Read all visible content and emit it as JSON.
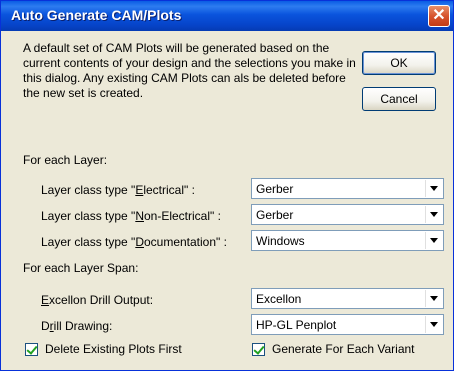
{
  "window": {
    "title": "Auto Generate CAM/Plots",
    "close_symbol": "✕"
  },
  "description": "A default set of CAM Plots will be generated based on the current contents of your design and the selections you make in this dialog. Any existing CAM Plots can als be deleted before the new set is created.",
  "buttons": {
    "ok_label": "OK",
    "cancel_label": "Cancel"
  },
  "layer_section": {
    "heading": "For each Layer:",
    "fields": [
      {
        "label_pre": "Layer class type \"",
        "label_ul": "E",
        "label_post": "lectrical\" :",
        "value": "Gerber"
      },
      {
        "label_pre": "Layer class type \"",
        "label_ul": "N",
        "label_post": "on-Electrical\" :",
        "value": "Gerber"
      },
      {
        "label_pre": "Layer class type \"",
        "label_ul": "D",
        "label_post": "ocumentation\" :",
        "value": "Windows"
      }
    ]
  },
  "span_section": {
    "heading": "For each Layer Span:",
    "fields": [
      {
        "label_pre": "",
        "label_ul": "E",
        "label_post": "xcellon Drill Output:",
        "value": "Excellon"
      },
      {
        "label_pre": "D",
        "label_ul": "r",
        "label_post": "ill Drawing:",
        "value": "HP-GL Penplot"
      }
    ]
  },
  "checkboxes": {
    "delete_existing": {
      "label": "Delete Existing Plots First",
      "checked": true
    },
    "each_variant": {
      "label": "Generate For Each Variant",
      "checked": true
    }
  },
  "colors": {
    "titlebar": "#0a54dd",
    "dialog_bg": "#ece9d8",
    "check_mark": "#21a121"
  }
}
